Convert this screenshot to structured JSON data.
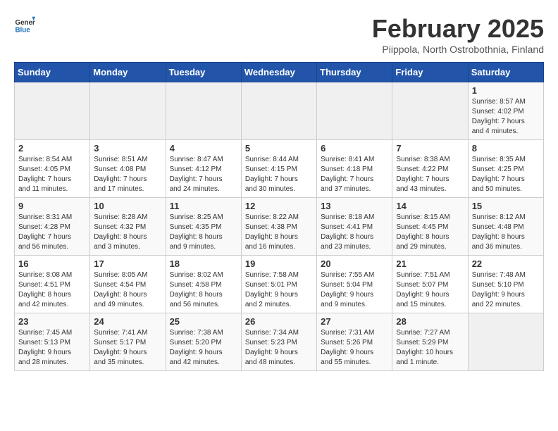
{
  "header": {
    "logo_general": "General",
    "logo_blue": "Blue",
    "month_title": "February 2025",
    "location": "Piippola, North Ostrobothnia, Finland"
  },
  "days_of_week": [
    "Sunday",
    "Monday",
    "Tuesday",
    "Wednesday",
    "Thursday",
    "Friday",
    "Saturday"
  ],
  "weeks": [
    [
      {
        "day": "",
        "info": ""
      },
      {
        "day": "",
        "info": ""
      },
      {
        "day": "",
        "info": ""
      },
      {
        "day": "",
        "info": ""
      },
      {
        "day": "",
        "info": ""
      },
      {
        "day": "",
        "info": ""
      },
      {
        "day": "1",
        "info": "Sunrise: 8:57 AM\nSunset: 4:02 PM\nDaylight: 7 hours\nand 4 minutes."
      }
    ],
    [
      {
        "day": "2",
        "info": "Sunrise: 8:54 AM\nSunset: 4:05 PM\nDaylight: 7 hours\nand 11 minutes."
      },
      {
        "day": "3",
        "info": "Sunrise: 8:51 AM\nSunset: 4:08 PM\nDaylight: 7 hours\nand 17 minutes."
      },
      {
        "day": "4",
        "info": "Sunrise: 8:47 AM\nSunset: 4:12 PM\nDaylight: 7 hours\nand 24 minutes."
      },
      {
        "day": "5",
        "info": "Sunrise: 8:44 AM\nSunset: 4:15 PM\nDaylight: 7 hours\nand 30 minutes."
      },
      {
        "day": "6",
        "info": "Sunrise: 8:41 AM\nSunset: 4:18 PM\nDaylight: 7 hours\nand 37 minutes."
      },
      {
        "day": "7",
        "info": "Sunrise: 8:38 AM\nSunset: 4:22 PM\nDaylight: 7 hours\nand 43 minutes."
      },
      {
        "day": "8",
        "info": "Sunrise: 8:35 AM\nSunset: 4:25 PM\nDaylight: 7 hours\nand 50 minutes."
      }
    ],
    [
      {
        "day": "9",
        "info": "Sunrise: 8:31 AM\nSunset: 4:28 PM\nDaylight: 7 hours\nand 56 minutes."
      },
      {
        "day": "10",
        "info": "Sunrise: 8:28 AM\nSunset: 4:32 PM\nDaylight: 8 hours\nand 3 minutes."
      },
      {
        "day": "11",
        "info": "Sunrise: 8:25 AM\nSunset: 4:35 PM\nDaylight: 8 hours\nand 9 minutes."
      },
      {
        "day": "12",
        "info": "Sunrise: 8:22 AM\nSunset: 4:38 PM\nDaylight: 8 hours\nand 16 minutes."
      },
      {
        "day": "13",
        "info": "Sunrise: 8:18 AM\nSunset: 4:41 PM\nDaylight: 8 hours\nand 23 minutes."
      },
      {
        "day": "14",
        "info": "Sunrise: 8:15 AM\nSunset: 4:45 PM\nDaylight: 8 hours\nand 29 minutes."
      },
      {
        "day": "15",
        "info": "Sunrise: 8:12 AM\nSunset: 4:48 PM\nDaylight: 8 hours\nand 36 minutes."
      }
    ],
    [
      {
        "day": "16",
        "info": "Sunrise: 8:08 AM\nSunset: 4:51 PM\nDaylight: 8 hours\nand 42 minutes."
      },
      {
        "day": "17",
        "info": "Sunrise: 8:05 AM\nSunset: 4:54 PM\nDaylight: 8 hours\nand 49 minutes."
      },
      {
        "day": "18",
        "info": "Sunrise: 8:02 AM\nSunset: 4:58 PM\nDaylight: 8 hours\nand 56 minutes."
      },
      {
        "day": "19",
        "info": "Sunrise: 7:58 AM\nSunset: 5:01 PM\nDaylight: 9 hours\nand 2 minutes."
      },
      {
        "day": "20",
        "info": "Sunrise: 7:55 AM\nSunset: 5:04 PM\nDaylight: 9 hours\nand 9 minutes."
      },
      {
        "day": "21",
        "info": "Sunrise: 7:51 AM\nSunset: 5:07 PM\nDaylight: 9 hours\nand 15 minutes."
      },
      {
        "day": "22",
        "info": "Sunrise: 7:48 AM\nSunset: 5:10 PM\nDaylight: 9 hours\nand 22 minutes."
      }
    ],
    [
      {
        "day": "23",
        "info": "Sunrise: 7:45 AM\nSunset: 5:13 PM\nDaylight: 9 hours\nand 28 minutes."
      },
      {
        "day": "24",
        "info": "Sunrise: 7:41 AM\nSunset: 5:17 PM\nDaylight: 9 hours\nand 35 minutes."
      },
      {
        "day": "25",
        "info": "Sunrise: 7:38 AM\nSunset: 5:20 PM\nDaylight: 9 hours\nand 42 minutes."
      },
      {
        "day": "26",
        "info": "Sunrise: 7:34 AM\nSunset: 5:23 PM\nDaylight: 9 hours\nand 48 minutes."
      },
      {
        "day": "27",
        "info": "Sunrise: 7:31 AM\nSunset: 5:26 PM\nDaylight: 9 hours\nand 55 minutes."
      },
      {
        "day": "28",
        "info": "Sunrise: 7:27 AM\nSunset: 5:29 PM\nDaylight: 10 hours\nand 1 minute."
      },
      {
        "day": "",
        "info": ""
      }
    ]
  ]
}
